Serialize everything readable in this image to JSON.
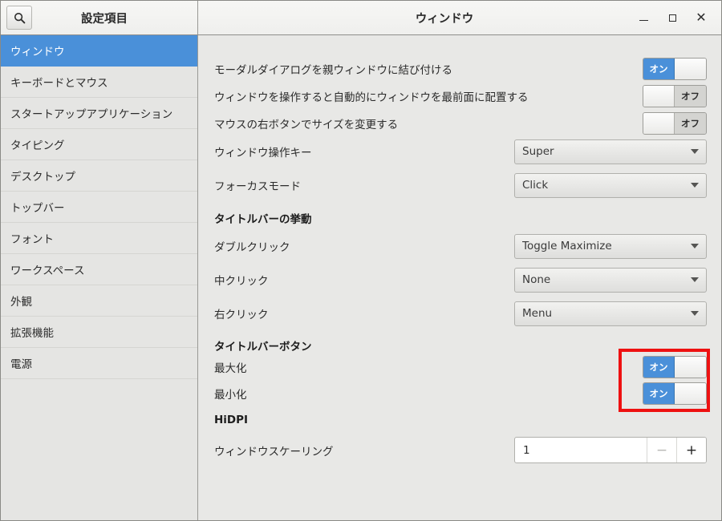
{
  "header": {
    "search_icon": "search-icon",
    "sidebar_title": "設定項目",
    "window_title": "ウィンドウ",
    "controls": {
      "minimize": "minimize-icon",
      "maximize": "maximize-icon",
      "close": "close-icon"
    }
  },
  "colors": {
    "accent": "#4a90d9",
    "highlight": "#ee1111",
    "window_bg": "#e8e8e6",
    "sidebar_bg": "#e5e5e3"
  },
  "sidebar": {
    "items": [
      {
        "label": "ウィンドウ",
        "selected": true
      },
      {
        "label": "キーボードとマウス",
        "selected": false
      },
      {
        "label": "スタートアップアプリケーション",
        "selected": false
      },
      {
        "label": "タイピング",
        "selected": false
      },
      {
        "label": "デスクトップ",
        "selected": false
      },
      {
        "label": "トップバー",
        "selected": false
      },
      {
        "label": "フォント",
        "selected": false
      },
      {
        "label": "ワークスペース",
        "selected": false
      },
      {
        "label": "外観",
        "selected": false
      },
      {
        "label": "拡張機能",
        "selected": false
      },
      {
        "label": "電源",
        "selected": false
      }
    ]
  },
  "main": {
    "toggles_top": [
      {
        "label": "モーダルダイアログを親ウィンドウに結び付ける",
        "state": "on",
        "state_label": "オン"
      },
      {
        "label": "ウィンドウを操作すると自動的にウィンドウを最前面に配置する",
        "state": "off",
        "state_label": "オフ"
      },
      {
        "label": "マウスの右ボタンでサイズを変更する",
        "state": "off",
        "state_label": "オフ"
      }
    ],
    "dropdowns_top": [
      {
        "label": "ウィンドウ操作キー",
        "value": "Super"
      },
      {
        "label": "フォーカスモード",
        "value": "Click"
      }
    ],
    "section_titlebar_action": "タイトルバーの挙動",
    "dropdowns_titlebar": [
      {
        "label": "ダブルクリック",
        "value": "Toggle Maximize"
      },
      {
        "label": "中クリック",
        "value": "None"
      },
      {
        "label": "右クリック",
        "value": "Menu"
      }
    ],
    "section_titlebar_buttons": "タイトルバーボタン",
    "toggles_titlebar": [
      {
        "label": "最大化",
        "state": "on",
        "state_label": "オン"
      },
      {
        "label": "最小化",
        "state": "on",
        "state_label": "オン"
      }
    ],
    "section_hidpi": "HiDPI",
    "spinner": {
      "label": "ウィンドウスケーリング",
      "value": "1",
      "decrement_label": "−",
      "increment_label": "+",
      "decrement_enabled": false,
      "increment_enabled": true
    }
  }
}
